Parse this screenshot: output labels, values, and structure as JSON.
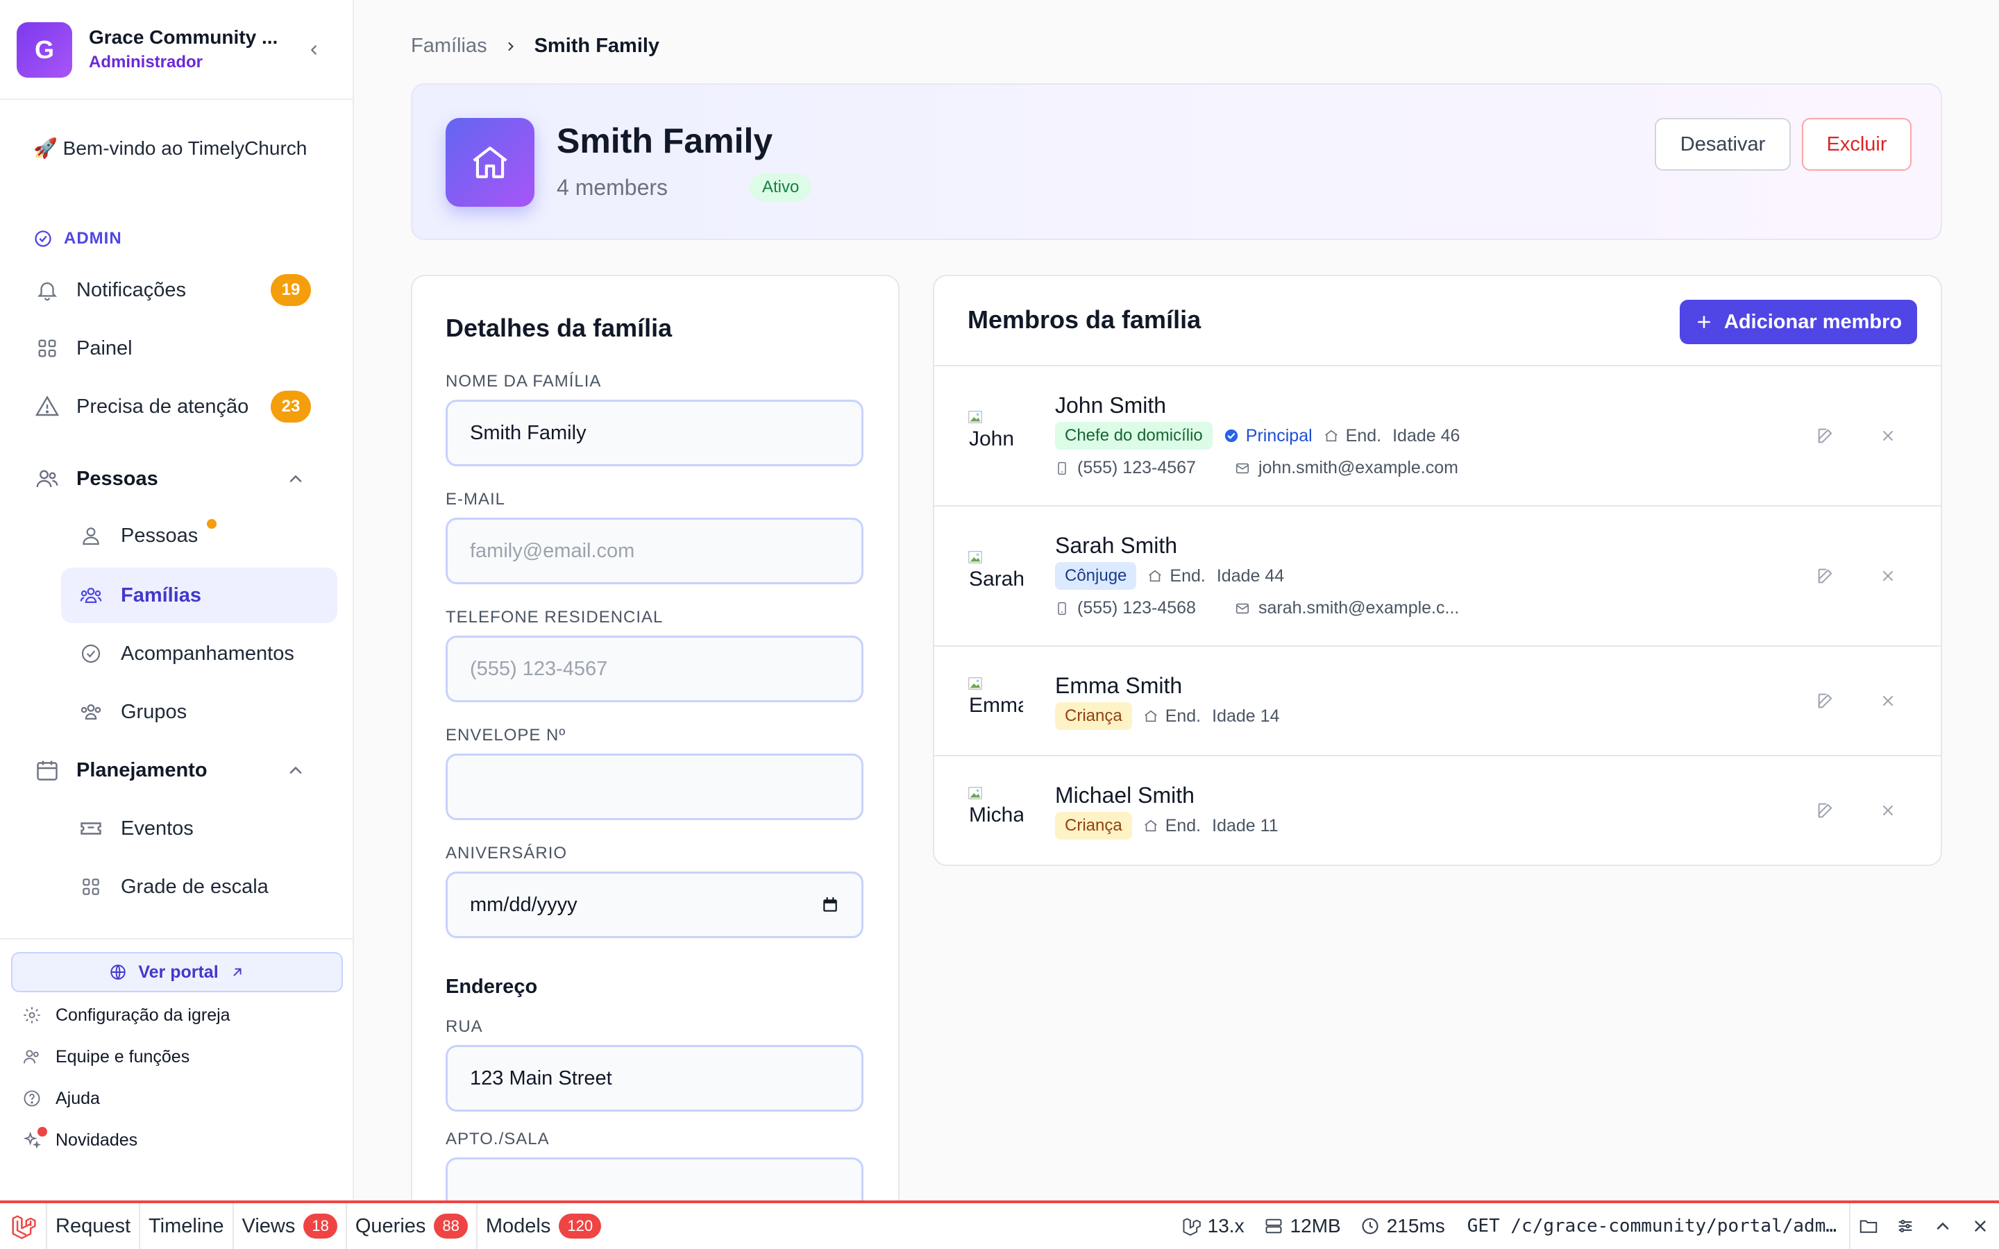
{
  "org": {
    "initial": "G",
    "name": "Grace Community ...",
    "role": "Administrador"
  },
  "sidebar": {
    "welcome": "🚀 Bem-vindo ao TimelyChurch",
    "section_label": "ADMIN",
    "items": [
      {
        "label": "Notificações",
        "badge": "19"
      },
      {
        "label": "Painel"
      },
      {
        "label": "Precisa de atenção",
        "badge": "23"
      }
    ],
    "group_people": {
      "label": "Pessoas",
      "items": [
        "Pessoas",
        "Famílias",
        "Acompanhamentos",
        "Grupos"
      ]
    },
    "group_planning": {
      "label": "Planejamento",
      "items": [
        "Eventos",
        "Grade de escala"
      ]
    },
    "portal_label": "Ver portal",
    "footer": [
      "Configuração da igreja",
      "Equipe e funções",
      "Ajuda",
      "Novidades"
    ]
  },
  "breadcrumb": {
    "parent": "Famílias",
    "current": "Smith Family"
  },
  "family": {
    "name": "Smith Family",
    "members_count": "4 members",
    "status": "Ativo",
    "deactivate_label": "Desativar",
    "delete_label": "Excluir"
  },
  "details": {
    "title": "Detalhes da família",
    "name_label": "NOME DA FAMÍLIA",
    "name_value": "Smith Family",
    "email_label": "E-MAIL",
    "email_placeholder": "family@email.com",
    "phone_label": "TELEFONE RESIDENCIAL",
    "phone_placeholder": "(555) 123-4567",
    "envelope_label": "ENVELOPE Nº",
    "envelope_value": "",
    "birthday_label": "ANIVERSÁRIO",
    "birthday_placeholder": "mm/dd/yyyy",
    "address_title": "Endereço",
    "street_label": "RUA",
    "street_value": "123 Main Street",
    "apt_label": "APTO./SALA",
    "apt_value": ""
  },
  "members": {
    "title": "Membros da família",
    "add_label": "Adicionar membro",
    "list": [
      {
        "name": "John Smith",
        "alt": "John",
        "role": "Chefe do domicílio",
        "primary": "Principal",
        "address": "End.",
        "age": "Idade 46",
        "phone": "(555) 123-4567",
        "email": "john.smith@example.com"
      },
      {
        "name": "Sarah Smith",
        "alt": "Sarah",
        "role": "Cônjuge",
        "address": "End.",
        "age": "Idade 44",
        "phone": "(555) 123-4568",
        "email": "sarah.smith@example.c..."
      },
      {
        "name": "Emma Smith",
        "alt": "Emma",
        "role": "Criança",
        "address": "End.",
        "age": "Idade 14"
      },
      {
        "name": "Michael Smith",
        "alt": "Michael",
        "role": "Criança",
        "address": "End.",
        "age": "Idade 11"
      }
    ]
  },
  "debugbar": {
    "tabs": [
      {
        "label": "Request"
      },
      {
        "label": "Timeline"
      },
      {
        "label": "Views",
        "count": "18"
      },
      {
        "label": "Queries",
        "count": "88"
      },
      {
        "label": "Models",
        "count": "120"
      }
    ],
    "version": "13.x",
    "memory": "12MB",
    "time": "215ms",
    "route": "GET /c/grace-community/portal/adm…"
  },
  "colors": {
    "accent": "#4f46e5",
    "brand_gradient_start": "#6366f1",
    "brand_gradient_end": "#a855f7",
    "badge": "#f59e0b",
    "danger": "#dc2626"
  }
}
